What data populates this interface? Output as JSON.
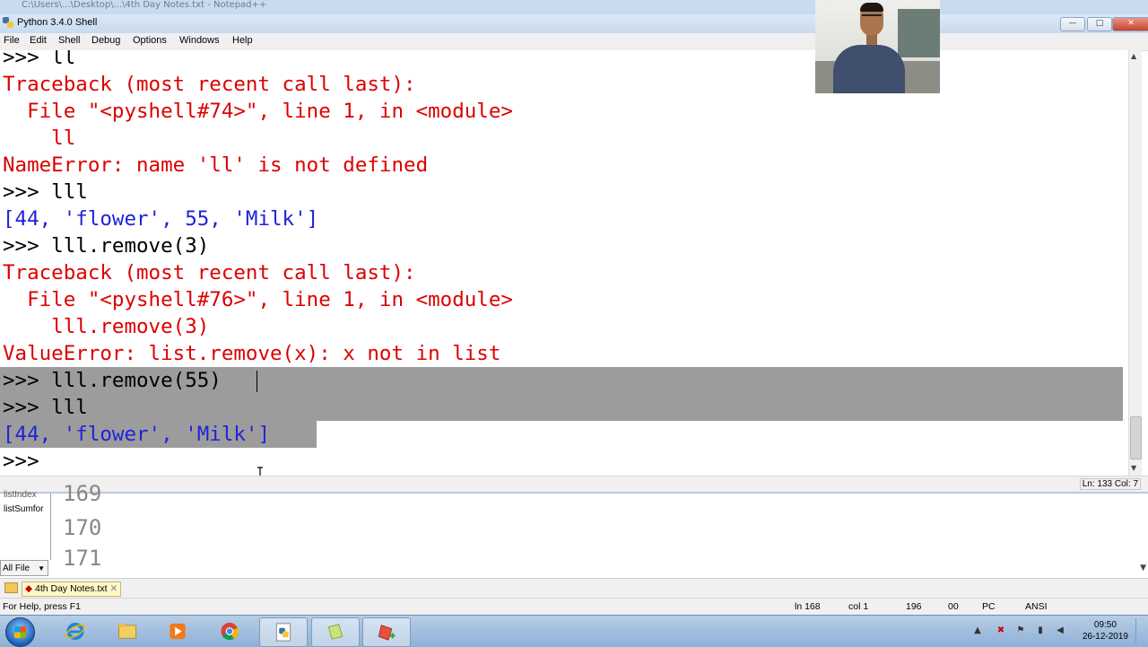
{
  "background_window": {
    "title_fragment": "C:\\Users\\...\\Desktop\\...\\4th Day Notes.txt - Notepad++"
  },
  "window": {
    "title": "Python 3.4.0 Shell",
    "buttons": {
      "minimize": "—",
      "maximize": "□",
      "close": "✕"
    }
  },
  "menu": [
    "File",
    "Edit",
    "Shell",
    "Debug",
    "Options",
    "Windows",
    "Help"
  ],
  "shell": {
    "lines": [
      {
        "text": ">>> ll",
        "style": "blk"
      },
      {
        "text": "Traceback (most recent call last):",
        "style": "red"
      },
      {
        "text": "  File \"<pyshell#74>\", line 1, in <module>",
        "style": "red"
      },
      {
        "text": "    ll",
        "style": "red"
      },
      {
        "text": "NameError: name 'll' is not defined",
        "style": "red"
      },
      {
        "text": ">>> lll",
        "style": "blk"
      },
      {
        "text": "[44, 'flower', 55, 'Milk']",
        "style": "blue"
      },
      {
        "text": ">>> lll.remove(3)",
        "style": "blk"
      },
      {
        "text": "Traceback (most recent call last):",
        "style": "red"
      },
      {
        "text": "  File \"<pyshell#76>\", line 1, in <module>",
        "style": "red"
      },
      {
        "text": "    lll.remove(3)",
        "style": "red"
      },
      {
        "text": "ValueError: list.remove(x): x not in list",
        "style": "red"
      },
      {
        "text": ">>> lll.remove(55)",
        "style": "blk"
      },
      {
        "text": ">>> lll",
        "style": "blk"
      },
      {
        "text": "[44, 'flower', 'Milk']",
        "style": "blue"
      },
      {
        "text": ">>> ",
        "style": "blk"
      }
    ],
    "status": "Ln: 133 Col: 7"
  },
  "editor": {
    "doc_list": [
      "listSumfor"
    ],
    "filter": "All File",
    "line_numbers": [
      "169",
      "170",
      "171"
    ],
    "tab": "4th Day Notes.txt",
    "status": {
      "help": "For Help, press F1",
      "ln": "ln 168",
      "col": "col 1",
      "chars": "196",
      "ovr": "00",
      "eol": "PC",
      "encoding": "ANSI"
    }
  },
  "taskbar": {
    "apps": [
      "windows-explorer",
      "internet-explorer",
      "file-explorer",
      "media-player",
      "chrome",
      "python-idle",
      "notepad",
      "notepad-plus-plus"
    ],
    "time": "09:50",
    "date": "26-12-2019"
  }
}
